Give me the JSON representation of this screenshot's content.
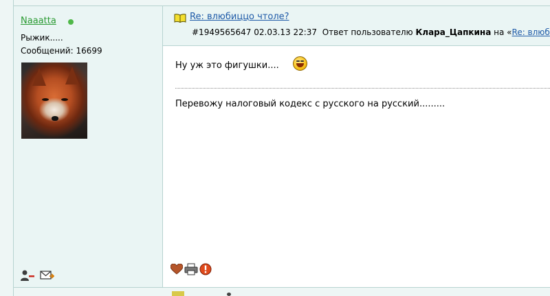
{
  "user": {
    "name": "Naaatta",
    "status": "Рыжик.....",
    "messages_label": "Сообщений: 16699",
    "online": true
  },
  "post": {
    "title": "Re: влюбиццо чтоле?",
    "id": "#1949565647",
    "date": "02.03.13 22:37",
    "reply_text": "Ответ пользователю",
    "reply_user": "Клара_Цапкина",
    "on_text": "на «",
    "reply_link": "Re: влюб",
    "line1": "Ну уж это фигушки....",
    "line2": "Перевожу налоговый кодекс с русского на русский........."
  },
  "colors": {
    "username": "#2a9a32",
    "link": "#1e5aa8",
    "sidebar_bg": "#eaf5f4",
    "border": "#b7d3d0"
  },
  "icons": {
    "profile": [
      "user-remove-icon",
      "mail-icon"
    ],
    "post": [
      "heart-icon",
      "print-icon",
      "report-icon"
    ],
    "title": "book-icon",
    "emoticon": "laughing-smiley-icon"
  }
}
